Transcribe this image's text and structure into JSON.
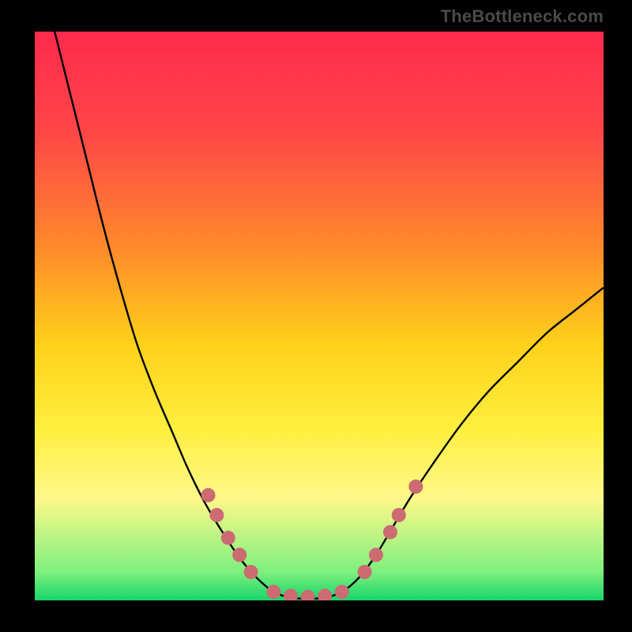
{
  "watermark": "TheBottleneck.com",
  "chart_data": {
    "type": "line",
    "title": "",
    "xlabel": "",
    "ylabel": "",
    "xlim": [
      0,
      100
    ],
    "ylim": [
      0,
      100
    ],
    "background_gradient": {
      "stops": [
        {
          "offset": 0.0,
          "color": "#ff2a4d"
        },
        {
          "offset": 0.18,
          "color": "#ff4747"
        },
        {
          "offset": 0.38,
          "color": "#ff8a2b"
        },
        {
          "offset": 0.55,
          "color": "#ffd11a"
        },
        {
          "offset": 0.7,
          "color": "#ffef3f"
        },
        {
          "offset": 0.82,
          "color": "#fff88a"
        },
        {
          "offset": 0.95,
          "color": "#7ef07e"
        },
        {
          "offset": 1.0,
          "color": "#18d46a"
        }
      ]
    },
    "series": [
      {
        "name": "bottleneck-curve",
        "color": "#000000",
        "points": [
          {
            "x": 3.5,
            "y": 100.0
          },
          {
            "x": 6.0,
            "y": 90.0
          },
          {
            "x": 9.0,
            "y": 78.0
          },
          {
            "x": 12.0,
            "y": 66.0
          },
          {
            "x": 15.0,
            "y": 55.0
          },
          {
            "x": 18.0,
            "y": 45.0
          },
          {
            "x": 21.0,
            "y": 37.0
          },
          {
            "x": 24.0,
            "y": 30.0
          },
          {
            "x": 27.0,
            "y": 23.0
          },
          {
            "x": 30.0,
            "y": 17.0
          },
          {
            "x": 33.0,
            "y": 12.0
          },
          {
            "x": 36.0,
            "y": 7.5
          },
          {
            "x": 39.0,
            "y": 4.0
          },
          {
            "x": 42.0,
            "y": 1.5
          },
          {
            "x": 45.0,
            "y": 0.5
          },
          {
            "x": 48.0,
            "y": 0.3
          },
          {
            "x": 51.0,
            "y": 0.5
          },
          {
            "x": 54.0,
            "y": 1.5
          },
          {
            "x": 57.0,
            "y": 4.0
          },
          {
            "x": 60.0,
            "y": 8.0
          },
          {
            "x": 63.0,
            "y": 13.0
          },
          {
            "x": 66.0,
            "y": 18.0
          },
          {
            "x": 70.0,
            "y": 24.0
          },
          {
            "x": 75.0,
            "y": 31.0
          },
          {
            "x": 80.0,
            "y": 37.0
          },
          {
            "x": 85.0,
            "y": 42.0
          },
          {
            "x": 90.0,
            "y": 47.0
          },
          {
            "x": 95.0,
            "y": 51.0
          },
          {
            "x": 100.0,
            "y": 55.0
          }
        ]
      }
    ],
    "markers": {
      "color": "#cc6b72",
      "radius": 9,
      "points": [
        {
          "x": 30.5,
          "y": 18.5
        },
        {
          "x": 32.0,
          "y": 15.0
        },
        {
          "x": 34.0,
          "y": 11.0
        },
        {
          "x": 36.0,
          "y": 8.0
        },
        {
          "x": 38.0,
          "y": 5.0
        },
        {
          "x": 42.0,
          "y": 1.5
        },
        {
          "x": 45.0,
          "y": 0.8
        },
        {
          "x": 48.0,
          "y": 0.6
        },
        {
          "x": 51.0,
          "y": 0.8
        },
        {
          "x": 54.0,
          "y": 1.5
        },
        {
          "x": 58.0,
          "y": 5.0
        },
        {
          "x": 60.0,
          "y": 8.0
        },
        {
          "x": 62.5,
          "y": 12.0
        },
        {
          "x": 64.0,
          "y": 15.0
        },
        {
          "x": 67.0,
          "y": 20.0
        }
      ]
    }
  }
}
